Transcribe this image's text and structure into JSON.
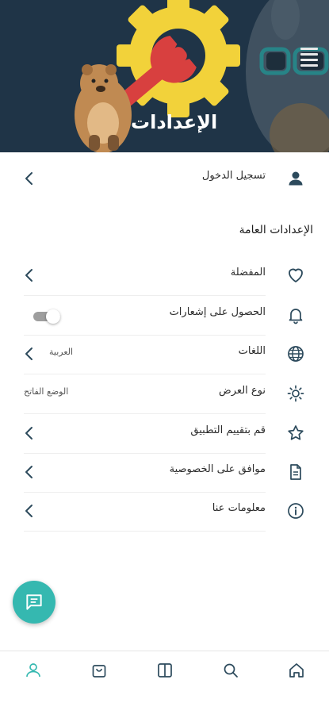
{
  "header": {
    "title": "الإعدادات",
    "menu_icon": "hamburger-icon",
    "illustration": "gear-wrench-quokka-illustration"
  },
  "account": {
    "login_label": "تسجيل الدخول",
    "icon": "person-icon"
  },
  "general": {
    "section_title": "الإعدادات العامة",
    "items": [
      {
        "label": "المفضلة",
        "icon": "heart-icon",
        "control": "chevron"
      },
      {
        "label": "الحصول على إشعارات",
        "icon": "bell-icon",
        "control": "toggle",
        "toggle_on": false
      },
      {
        "label": "اللغات",
        "icon": "globe-icon",
        "value": "العربية",
        "control": "chevron"
      },
      {
        "label": "نوع العرض",
        "icon": "sun-icon",
        "value": "الوضع الفاتح",
        "control": "value"
      },
      {
        "label": "قم بتقييم التطبيق",
        "icon": "star-icon",
        "control": "chevron"
      },
      {
        "label": "موافق على الخصوصية",
        "icon": "document-icon",
        "control": "chevron"
      },
      {
        "label": "معلومات عنا",
        "icon": "info-icon",
        "control": "chevron"
      }
    ]
  },
  "fab": {
    "icon": "chat-icon"
  },
  "bottom_nav": {
    "items": [
      {
        "icon": "profile-icon",
        "active": true
      },
      {
        "icon": "cart-icon",
        "active": false
      },
      {
        "icon": "book-icon",
        "active": false
      },
      {
        "icon": "search-icon",
        "active": false
      },
      {
        "icon": "home-icon",
        "active": false
      }
    ]
  },
  "colors": {
    "banner_bg": "#1f3447",
    "accent": "#35b8b0",
    "icon": "#2c4a5c",
    "gear": "#f2d23a",
    "wrench": "#d8403f"
  }
}
